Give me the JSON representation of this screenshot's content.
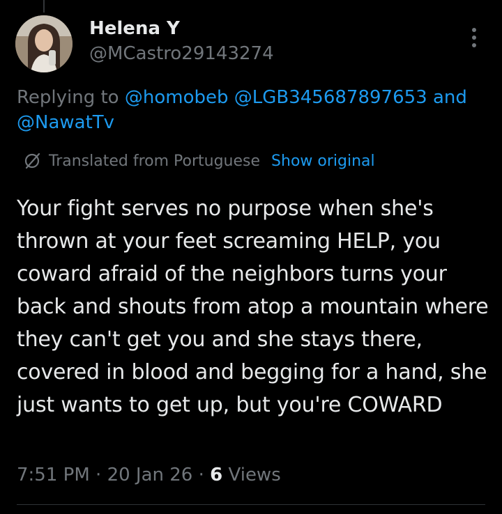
{
  "user": {
    "display_name": "Helena Y",
    "handle": "@MCastro29143274",
    "avatar_icon": "profile-photo"
  },
  "reply_context": {
    "prefix": "Replying to",
    "mentions": [
      "@homobeb",
      "@LGB345687897653"
    ],
    "joiner": "and",
    "last_mention": "@NawatTv"
  },
  "translation": {
    "icon": "globe-icon",
    "label": "Translated from Portuguese",
    "show_original": "Show original"
  },
  "tweet": {
    "text": "Your fight serves no purpose when she's thrown at your feet screaming HELP, you coward afraid of the neighbors turns your back and shouts from atop a mountain where they can't get you and she stays there, covered in blood and begging for a hand, she just wants to get up, but you're COWARD"
  },
  "meta": {
    "time": "7:51 PM",
    "date": "20 Jan 26",
    "separator": "·",
    "views_count": "6",
    "views_label": "Views"
  },
  "colors": {
    "background": "#000000",
    "text": "#e7e9ea",
    "secondary": "#71767b",
    "link": "#1d9bf0"
  }
}
